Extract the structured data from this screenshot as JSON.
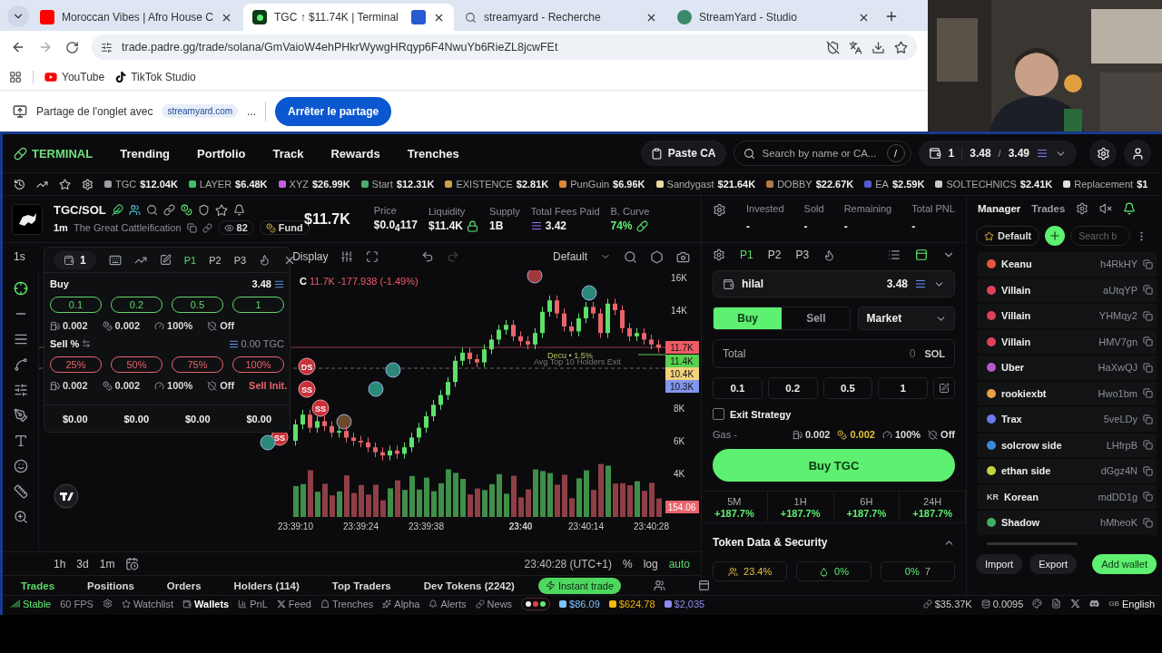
{
  "browser": {
    "tabs": [
      {
        "title": "Moroccan Vibes | Afro House C",
        "kind": "video",
        "selected": false
      },
      {
        "title": "TGC ↑ $11.74K | Terminal",
        "kind": "app",
        "selected": true
      },
      {
        "title": "streamyard - Recherche",
        "kind": "search",
        "selected": false
      },
      {
        "title": "StreamYard - Studio",
        "kind": "studio",
        "selected": false
      }
    ],
    "url": "trade.padre.gg/trade/solana/GmVaioW4ehPHkrWywgHRqyp6F4NwuYb6RieZL8jcwFEt",
    "bookmarks": [
      "YouTube",
      "TikTok Studio"
    ],
    "share_bar": {
      "text": "Partage de l'onglet avec",
      "site": "streamyard.com",
      "ellipsis": "...",
      "button": "Arrêter le partage"
    },
    "camera": {
      "kind": "picture"
    }
  },
  "nav": {
    "logo": "TERMINAL",
    "links": [
      "Trending",
      "Portfolio",
      "Track",
      "Rewards",
      "Trenches"
    ],
    "paste": "Paste CA",
    "search": {
      "placeholder": "Search by name or CA...",
      "shortcut": "/"
    },
    "wallet": {
      "count": "1",
      "balance": "3.48",
      "separator": "/",
      "total": "3.49"
    }
  },
  "ticker": [
    {
      "symbol": "TGC",
      "value": "$12.04K",
      "color": "#9aa0a6"
    },
    {
      "symbol": "LAYER",
      "value": "$6.48K",
      "color": "#3fbf6f"
    },
    {
      "symbol": "XYZ",
      "value": "$26.99K",
      "color": "#c060e0"
    },
    {
      "symbol": "Start",
      "value": "$12.31K",
      "color": "#4caf6a"
    },
    {
      "symbol": "EXISTENCE",
      "value": "$2.81K",
      "color": "#c9a24a"
    },
    {
      "symbol": "PunGuin",
      "value": "$6.96K",
      "color": "#d88a3a"
    },
    {
      "symbol": "Sandygast",
      "value": "$21.64K",
      "color": "#e8d9a0"
    },
    {
      "symbol": "DOBBY",
      "value": "$22.67K",
      "color": "#b07a4a"
    },
    {
      "symbol": "EA",
      "value": "$2.59K",
      "color": "#5a5ad0"
    },
    {
      "symbol": "SOLTECHNICS",
      "value": "$2.41K",
      "color": "#c8c8c8"
    },
    {
      "symbol": "Replacement",
      "value": "$1",
      "color": "#e0e0e0"
    }
  ],
  "token": {
    "pair": "TGC/SOL",
    "age": "1m",
    "name": "The Great Cattleification",
    "watchers": "82",
    "fund": "Fund",
    "market_cap": "$11.7K",
    "stats": [
      {
        "label": "Price",
        "value": "$0.0$_{4}$117",
        "kind": "plain"
      },
      {
        "label": "Liquidity",
        "value": "$11.4K",
        "kind": "locked"
      },
      {
        "label": "Supply",
        "value": "1B",
        "kind": "plain"
      },
      {
        "label": "Total Fees Paid",
        "value": "3.42",
        "kind": "sol"
      },
      {
        "label": "B. Curve",
        "value": "74%",
        "kind": "curve"
      }
    ]
  },
  "position": [
    {
      "label": "Invested",
      "value": "-"
    },
    {
      "label": "Sold",
      "value": "-"
    },
    {
      "label": "Remaining",
      "value": "-"
    },
    {
      "label": "Total PNL",
      "value": "-"
    }
  ],
  "chart_toolbar": {
    "interval": "1s",
    "display": "Display",
    "template": "Default"
  },
  "quick_panel": {
    "wallets": "1",
    "presets": [
      {
        "label": "P1",
        "selected": true
      },
      {
        "label": "P2",
        "selected": false
      },
      {
        "label": "P3",
        "selected": false
      }
    ],
    "buy_label": "Buy",
    "balance": "3.48",
    "buy_amounts": [
      "0.1",
      "0.2",
      "0.5",
      "1"
    ],
    "buy_settings": [
      "0.002",
      "0.002",
      "100%",
      "Off"
    ],
    "sell_label": "Sell %",
    "sell_balance": "0.00 TGC",
    "sell_amounts": [
      "25%",
      "50%",
      "75%",
      "100%"
    ],
    "sell_settings": [
      "0.002",
      "0.002",
      "100%",
      "Off"
    ],
    "sell_init": "Sell Init.",
    "totals": [
      "$0.00",
      "$0.00",
      "$0.00",
      "$0.00"
    ]
  },
  "chart": {
    "legend_close": "C",
    "legend_value": "11.7K",
    "legend_change": "-177.938 (-1.49%)",
    "chart_data": {
      "type": "candlestick",
      "categories": [
        "23:39:10",
        null,
        null,
        null,
        null,
        null,
        null,
        null,
        null,
        "23:39:24",
        null,
        null,
        null,
        null,
        null,
        null,
        null,
        null,
        "23:39:38",
        null,
        null,
        null,
        null,
        null,
        null,
        null,
        null,
        null,
        null,
        null,
        null,
        "23:40",
        null,
        null,
        null,
        null,
        null,
        null,
        null,
        null,
        "23:40:14",
        null,
        null,
        null,
        null,
        null,
        null,
        null,
        null,
        "23:40:28",
        null
      ],
      "ylim": [
        4,
        16
      ],
      "ohlc": [
        [
          6.0,
          7.3,
          5.7,
          7.0
        ],
        [
          7.0,
          7.9,
          6.7,
          7.6
        ],
        [
          7.6,
          7.9,
          6.5,
          6.8
        ],
        [
          6.8,
          7.5,
          6.5,
          7.2
        ],
        [
          7.2,
          7.5,
          6.6,
          6.9
        ],
        [
          6.9,
          7.2,
          6.2,
          6.5
        ],
        [
          6.5,
          6.9,
          6.2,
          6.6
        ],
        [
          6.6,
          6.9,
          5.9,
          6.2
        ],
        [
          6.2,
          6.5,
          5.7,
          6.0
        ],
        [
          6.0,
          6.3,
          5.6,
          5.9
        ],
        [
          5.9,
          6.2,
          5.3,
          5.6
        ],
        [
          5.6,
          5.9,
          5.0,
          5.3
        ],
        [
          5.3,
          5.6,
          4.8,
          5.1
        ],
        [
          5.1,
          5.7,
          4.8,
          5.4
        ],
        [
          5.4,
          5.7,
          4.9,
          5.2
        ],
        [
          5.2,
          5.9,
          4.9,
          5.6
        ],
        [
          5.6,
          6.5,
          5.3,
          6.2
        ],
        [
          6.2,
          7.1,
          5.9,
          6.8
        ],
        [
          6.8,
          7.8,
          6.5,
          7.5
        ],
        [
          7.5,
          8.5,
          7.2,
          8.2
        ],
        [
          8.2,
          9.1,
          7.9,
          8.8
        ],
        [
          8.8,
          9.9,
          8.5,
          9.6
        ],
        [
          9.6,
          11.2,
          9.3,
          10.9
        ],
        [
          10.9,
          11.7,
          10.6,
          11.4
        ],
        [
          11.4,
          11.7,
          10.7,
          11.0
        ],
        [
          11.0,
          11.3,
          10.5,
          10.8
        ],
        [
          10.8,
          11.9,
          10.5,
          11.6
        ],
        [
          11.6,
          12.5,
          11.3,
          12.2
        ],
        [
          12.2,
          13.1,
          11.9,
          12.8
        ],
        [
          12.8,
          13.4,
          12.5,
          13.1
        ],
        [
          13.1,
          13.4,
          12.1,
          12.4
        ],
        [
          12.4,
          12.7,
          11.8,
          12.1
        ],
        [
          12.1,
          12.4,
          11.6,
          11.9
        ],
        [
          11.9,
          12.9,
          11.6,
          12.6
        ],
        [
          12.6,
          14.2,
          12.3,
          13.9
        ],
        [
          13.9,
          14.9,
          13.6,
          14.6
        ],
        [
          14.6,
          14.9,
          13.5,
          13.8
        ],
        [
          13.8,
          14.1,
          12.7,
          13.0
        ],
        [
          13.0,
          13.3,
          12.4,
          12.7
        ],
        [
          12.7,
          13.8,
          12.4,
          13.5
        ],
        [
          13.5,
          14.5,
          13.2,
          14.2
        ],
        [
          14.2,
          14.5,
          13.5,
          13.8
        ],
        [
          13.8,
          14.1,
          12.3,
          12.6
        ],
        [
          12.6,
          14.7,
          12.3,
          14.4
        ],
        [
          14.4,
          14.7,
          13.7,
          14.0
        ],
        [
          14.0,
          14.3,
          12.6,
          12.9
        ],
        [
          12.9,
          13.2,
          12.1,
          12.4
        ],
        [
          12.4,
          12.9,
          12.1,
          12.6
        ],
        [
          12.6,
          12.9,
          11.9,
          12.2
        ],
        [
          12.2,
          12.5,
          11.6,
          11.9
        ],
        [
          11.9,
          12.2,
          11.4,
          11.7
        ]
      ],
      "yticks": [
        {
          "value": 16,
          "label": "16K"
        },
        {
          "value": 14,
          "label": "14K"
        },
        {
          "value": 8,
          "label": "8K"
        },
        {
          "value": 6,
          "label": "6K"
        },
        {
          "value": 4,
          "label": "4K"
        }
      ]
    },
    "price_tags": [
      {
        "text": "11.7K",
        "color": "#ef5c66"
      },
      {
        "text": "11.4K",
        "color": "#58d050"
      },
      {
        "text": "10.4K",
        "color": "#f2d27c"
      },
      {
        "text": "10.3K",
        "color": "#8296ee"
      }
    ],
    "volume_tag": "154.06",
    "line_labels": [
      "Decu • 1.5%",
      "Avg Top 10 Holders Exit"
    ],
    "markers": [
      "DS",
      "SS",
      "SS",
      "SS"
    ],
    "ranges": [
      "1h",
      "3d",
      "1m"
    ],
    "timezone": "23:40:28 (UTC+1)",
    "scale_options": [
      {
        "label": "%",
        "selected": false
      },
      {
        "label": "log",
        "selected": false
      },
      {
        "label": "auto",
        "selected": true
      }
    ]
  },
  "trade_panel": {
    "presets": [
      {
        "label": "P1",
        "selected": true
      },
      {
        "label": "P2",
        "selected": false
      },
      {
        "label": "P3",
        "selected": false
      }
    ],
    "wallet_name": "hilal",
    "wallet_balance": "3.48",
    "sides": [
      {
        "label": "Buy",
        "selected": true
      },
      {
        "label": "Sell",
        "selected": false
      }
    ],
    "order_type": "Market",
    "total_label": "Total",
    "total_placeholder": "0",
    "total_unit": "SOL",
    "amounts": [
      "0.1",
      "0.2",
      "0.5",
      "1"
    ],
    "exit_strategy": {
      "label": "Exit Strategy",
      "checked": false
    },
    "gas_label": "Gas -",
    "gas": [
      "0.002",
      "0.002",
      "100%",
      "Off"
    ],
    "submit": "Buy TGC",
    "changes": [
      {
        "period": "5M",
        "value": "+187.7%"
      },
      {
        "period": "1H",
        "value": "+187.7%"
      },
      {
        "period": "6H",
        "value": "+187.7%"
      },
      {
        "period": "24H",
        "value": "+187.7%"
      }
    ],
    "security_title": "Token Data & Security",
    "security_expanded": true,
    "security_stats": [
      "23.4%",
      "0%",
      "0%",
      "7"
    ]
  },
  "manager": {
    "tabs": [
      {
        "label": "Manager",
        "selected": true
      },
      {
        "label": "Trades",
        "selected": false
      }
    ],
    "group": "Default",
    "search_placeholder": "Search b",
    "wallets": [
      {
        "name": "Keanu",
        "address": "h4RkHY",
        "color": "#e5573c"
      },
      {
        "name": "Villain",
        "address": "aUtqYP",
        "color": "#e0405a"
      },
      {
        "name": "Villain",
        "address": "YHMqy2",
        "color": "#e0405a"
      },
      {
        "name": "Villain",
        "address": "HMV7gn",
        "color": "#e0405a"
      },
      {
        "name": "Uber",
        "address": "HaXwQJ",
        "color": "#b05ad0"
      },
      {
        "name": "rookiexbt",
        "address": "Hwo1bm",
        "color": "#e8a040"
      },
      {
        "name": "Trax",
        "address": "5veLDy",
        "color": "#6a7ae8"
      },
      {
        "name": "solcrow side",
        "address": "LHfrpB",
        "color": "#3a8ae0"
      },
      {
        "name": "ethan side",
        "address": "dGgz4N",
        "color": "#c8d040"
      },
      {
        "name": "Korean",
        "address": "mdDD1g",
        "badge": "KR"
      },
      {
        "name": "Shadow",
        "address": "hMheoK",
        "color": "#40b060"
      }
    ],
    "buttons": [
      "Import",
      "Export",
      "Add wallet"
    ]
  },
  "bottom_tabs": [
    {
      "label": "Trades",
      "selected": true
    },
    {
      "label": "Positions",
      "selected": false
    },
    {
      "label": "Orders",
      "selected": false
    },
    {
      "label": "Holders (114)",
      "selected": false
    },
    {
      "label": "Top Traders",
      "selected": false
    },
    {
      "label": "Dev Tokens (2242)",
      "selected": false
    }
  ],
  "instant_trade": "Instant trade",
  "status_bar": {
    "connection": "Stable",
    "fps": "60 FPS",
    "links": [
      {
        "label": "Watchlist",
        "selected": false
      },
      {
        "label": "Wallets",
        "selected": true
      },
      {
        "label": "PnL",
        "selected": false
      },
      {
        "label": "Feed",
        "selected": false
      },
      {
        "label": "Trenches",
        "selected": false
      },
      {
        "label": "Alpha",
        "selected": false
      },
      {
        "label": "Alerts",
        "selected": false
      },
      {
        "label": "News",
        "selected": false
      }
    ],
    "prices": [
      {
        "value": "$86.09",
        "color": "#7fc4ff"
      },
      {
        "value": "$624.78",
        "color": "#f0b90b"
      },
      {
        "value": "$2,035",
        "color": "#8c8cf0"
      }
    ],
    "stats": [
      "$35.37K",
      "0.0095"
    ],
    "language": {
      "flag": "GB",
      "label": "English"
    }
  }
}
